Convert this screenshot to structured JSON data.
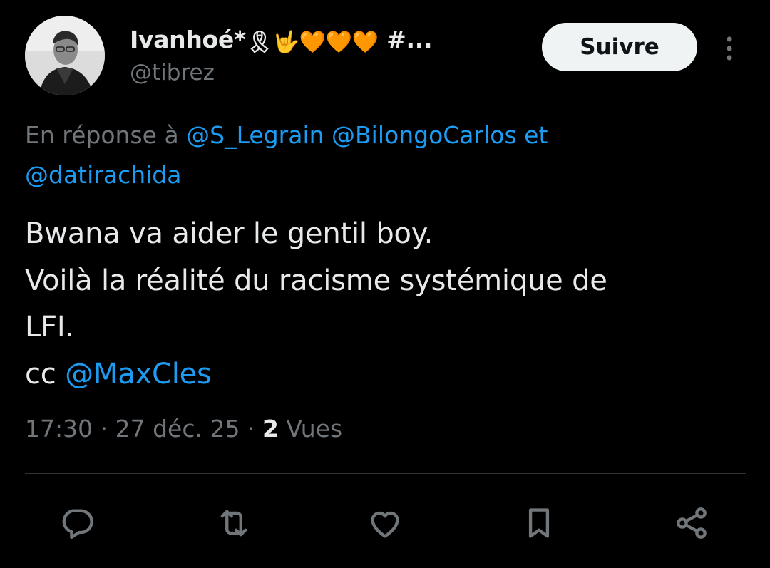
{
  "author": {
    "display_name": "Ivanhoé*",
    "name_emojis": "🎗🤟🧡🧡🧡",
    "name_suffix": " #...",
    "handle": "@tibrez",
    "avatar": "profile-photo"
  },
  "follow_label": "Suivre",
  "reply_context": {
    "prefix": "En réponse à ",
    "mention_1": "@S_Legrain",
    "mention_2": "@BilongoCarlos",
    "conjunction": " et",
    "mention_3": "@datirachida"
  },
  "tweet": {
    "line_1": "Bwana va aider le gentil boy.",
    "line_2": "Voilà la réalité du racisme systémique de",
    "line_3": "LFI.",
    "line_4_prefix": "cc ",
    "line_4_mention": "@MaxCles"
  },
  "meta": {
    "time": "17:30",
    "separator": " · ",
    "date": "27 déc. 25",
    "views_count": "2",
    "views_label": " Vues"
  },
  "actions": [
    "reply-icon",
    "repost-icon",
    "like-icon",
    "bookmark-icon",
    "share-icon"
  ],
  "colors": {
    "background": "#000000",
    "text": "#e7e9ea",
    "secondary": "#71767b",
    "link": "#1d9bf0",
    "divider": "#2f3336",
    "button_bg": "#eff3f4"
  }
}
